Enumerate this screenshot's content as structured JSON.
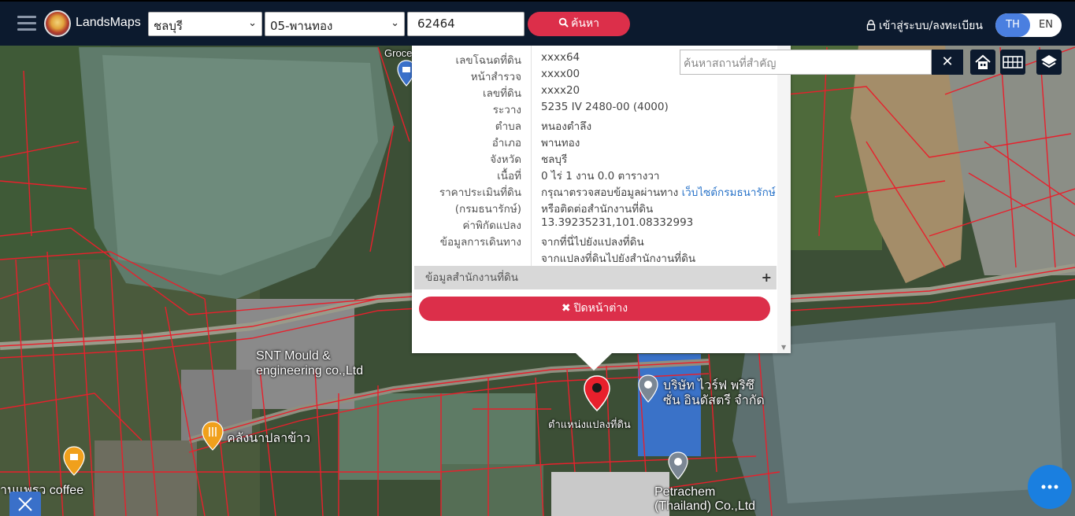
{
  "app": {
    "brand": "LandsMaps"
  },
  "topbar": {
    "province": "ชลบุรี",
    "district": "05-พานทอง",
    "deed_number": "62464",
    "search_label": "ค้นหา",
    "login_label": "เข้าสู่ระบบ/ลงทะเบียน",
    "lang_th": "TH",
    "lang_en": "EN"
  },
  "parcel": {
    "rows": [
      {
        "label": "เลขโฉนดที่ดิน",
        "value": "xxxx64"
      },
      {
        "label": "หน้าสำรวจ",
        "value": "xxxx00"
      },
      {
        "label": "เลขที่ดิน",
        "value": "xxxx20"
      },
      {
        "label": "ระวาง",
        "value": "5235 IV 2480-00 (4000)"
      },
      {
        "label": "ตำบล",
        "value": "หนองตำลึง"
      },
      {
        "label": "อำเภอ",
        "value": "พานทอง"
      },
      {
        "label": "จังหวัด",
        "value": "ชลบุรี"
      },
      {
        "label": "เนื้อที่",
        "value": "0 ไร่ 1 งาน 0.0 ตารางวา"
      }
    ],
    "price_label_1": "ราคาประเมินที่ดิน",
    "price_label_2": "(กรมธนารักษ์)",
    "price_text": "กรุณาตรวจสอบข้อมูลผ่านทาง",
    "price_link": "เว็บไซต์กรมธนารักษ์",
    "price_text_2": "หรือติดต่อสำนักงานที่ดิน",
    "coord_label": "ค่าพิกัดแปลง",
    "coord_value": "13.39235231,101.08332993",
    "travel_label": "ข้อมูลการเดินทาง",
    "travel_link_1": "จากที่นี่ไปยังแปลงที่ดิน",
    "travel_link_2": "จากแปลงที่ดินไปยังสำนักงานที่ดิน",
    "office_section": "ข้อมูลสำนักงานที่ดิน",
    "close_label": "ปิดหน้าต่าง"
  },
  "place_search": {
    "placeholder": "ค้นหาสถานที่สำคัญ"
  },
  "map_labels": {
    "grocery": "Groce",
    "snt_1": "SNT Mould &",
    "snt_2": "engineering co.,Ltd",
    "fish": "คลังนาปลาข้าว",
    "coffee": "านแพรว coffee",
    "parcel_marker": "ตำแหน่งแปลงที่ดิน",
    "company_1": "บริษัท ไวร์ฟ พริซึ",
    "company_2": "ซั่น อินดัสตรี จำกัด",
    "petra_1": "Petrachem",
    "petra_2": "(Thailand) Co.,Ltd"
  },
  "colors": {
    "nav_bg": "#0c1a2e",
    "accent_red": "#dc2f4a",
    "link_blue": "#2a74c9",
    "lang_active": "#4a7fe0",
    "parcel_line": "#e8202c"
  }
}
